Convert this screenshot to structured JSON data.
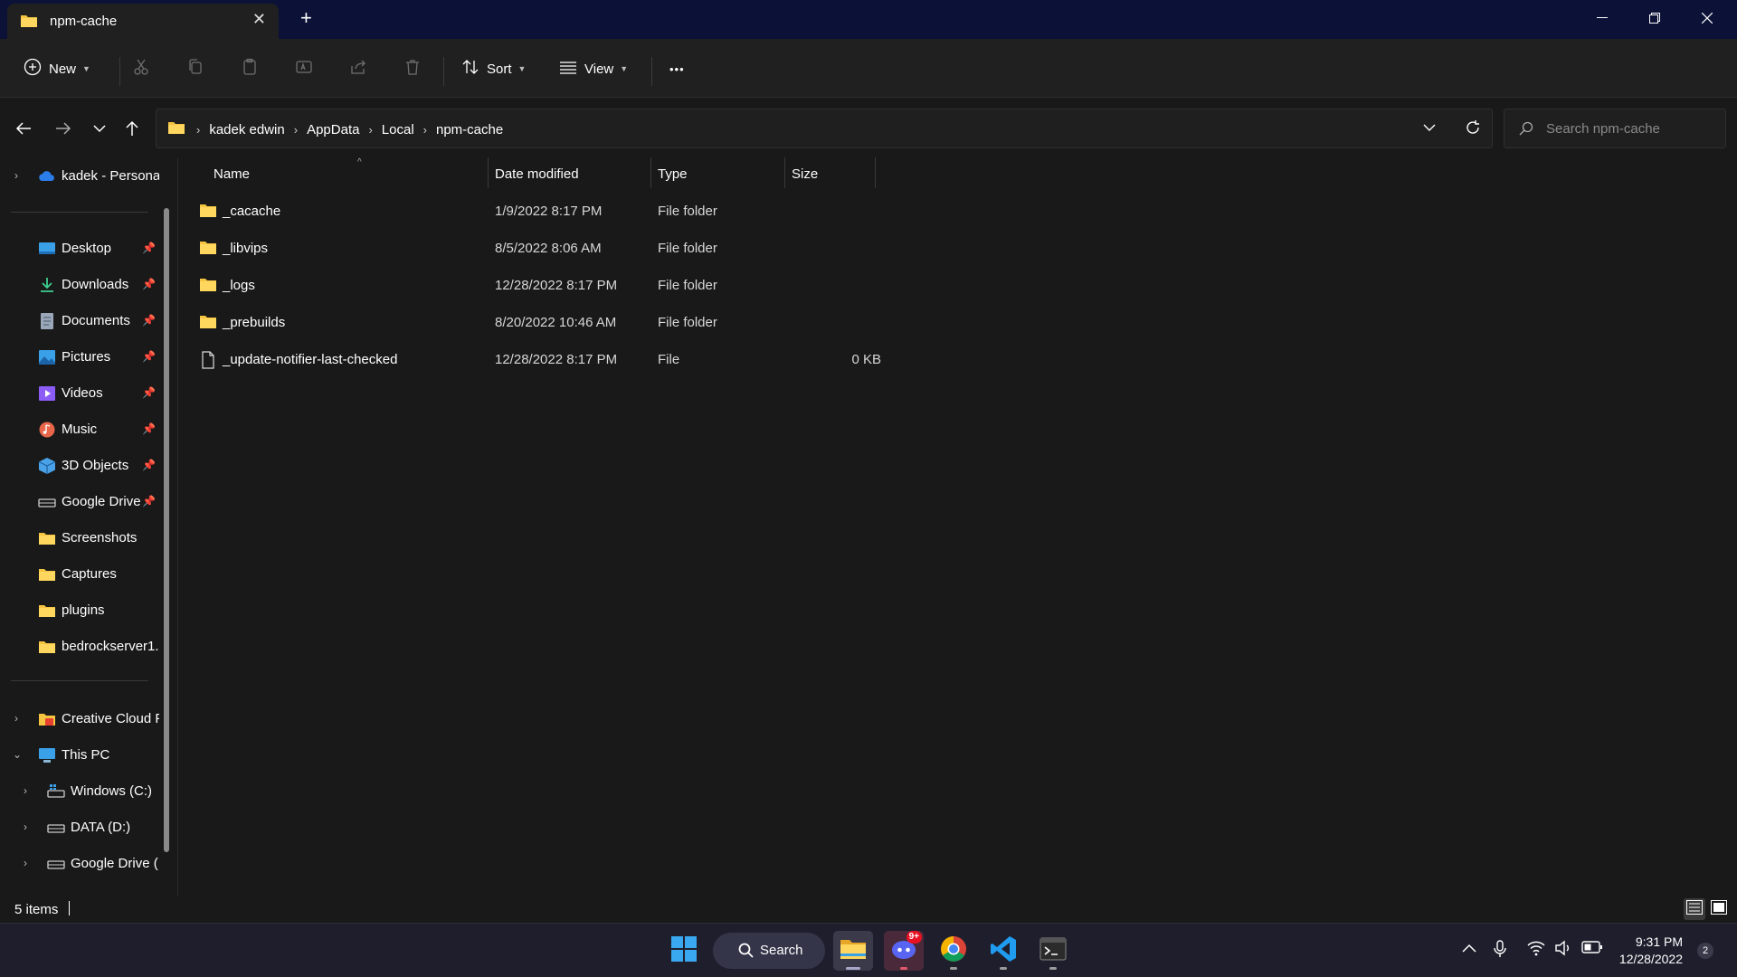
{
  "window": {
    "tab_title": "npm-cache",
    "new_tab": "+",
    "close_tab": "✕"
  },
  "toolbar": {
    "new_label": "New",
    "sort_label": "Sort",
    "view_label": "View",
    "more_label": "•••"
  },
  "address": {
    "breadcrumbs": [
      "kadek edwin",
      "AppData",
      "Local",
      "npm-cache"
    ]
  },
  "search": {
    "placeholder": "Search npm-cache"
  },
  "sidebar": {
    "onedrive": "kadek - Personal",
    "quick_access": [
      {
        "label": "Desktop",
        "icon": "desktop-icon"
      },
      {
        "label": "Downloads",
        "icon": "download-icon"
      },
      {
        "label": "Documents",
        "icon": "documents-icon"
      },
      {
        "label": "Pictures",
        "icon": "pictures-icon"
      },
      {
        "label": "Videos",
        "icon": "videos-icon"
      },
      {
        "label": "Music",
        "icon": "music-icon"
      },
      {
        "label": "3D Objects",
        "icon": "3d-objects-icon"
      },
      {
        "label": "Google Drive",
        "icon": "drive-icon"
      },
      {
        "label": "Screenshots",
        "icon": "folder-icon"
      },
      {
        "label": "Captures",
        "icon": "folder-icon"
      },
      {
        "label": "plugins",
        "icon": "folder-icon"
      },
      {
        "label": "bedrockserver1.",
        "icon": "folder-icon"
      }
    ],
    "creative_cloud": "Creative Cloud F",
    "this_pc": "This PC",
    "drives": [
      {
        "label": "Windows (C:)",
        "icon": "windows-drive-icon"
      },
      {
        "label": "DATA (D:)",
        "icon": "drive-icon"
      },
      {
        "label": "Google Drive (",
        "icon": "drive-icon"
      }
    ]
  },
  "columns": {
    "name": "Name",
    "date": "Date modified",
    "type": "Type",
    "size": "Size"
  },
  "files": [
    {
      "name": "_cacache",
      "date": "1/9/2022 8:17 PM",
      "type": "File folder",
      "size": "",
      "icon": "folder-icon"
    },
    {
      "name": "_libvips",
      "date": "8/5/2022 8:06 AM",
      "type": "File folder",
      "size": "",
      "icon": "folder-icon"
    },
    {
      "name": "_logs",
      "date": "12/28/2022 8:17 PM",
      "type": "File folder",
      "size": "",
      "icon": "folder-icon"
    },
    {
      "name": "_prebuilds",
      "date": "8/20/2022 10:46 AM",
      "type": "File folder",
      "size": "",
      "icon": "folder-icon"
    },
    {
      "name": "_update-notifier-last-checked",
      "date": "12/28/2022 8:17 PM",
      "type": "File",
      "size": "0 KB",
      "icon": "file-icon"
    }
  ],
  "status": {
    "item_count": "5 items"
  },
  "taskbar": {
    "search_label": "Search",
    "discord_badge": "9+",
    "time": "9:31 PM",
    "date": "12/28/2022",
    "notifications": "2"
  },
  "colors": {
    "titlebar": "#0b1137",
    "background": "#191919",
    "folder": "#f5c542",
    "taskbar": "#1f1e2d"
  }
}
